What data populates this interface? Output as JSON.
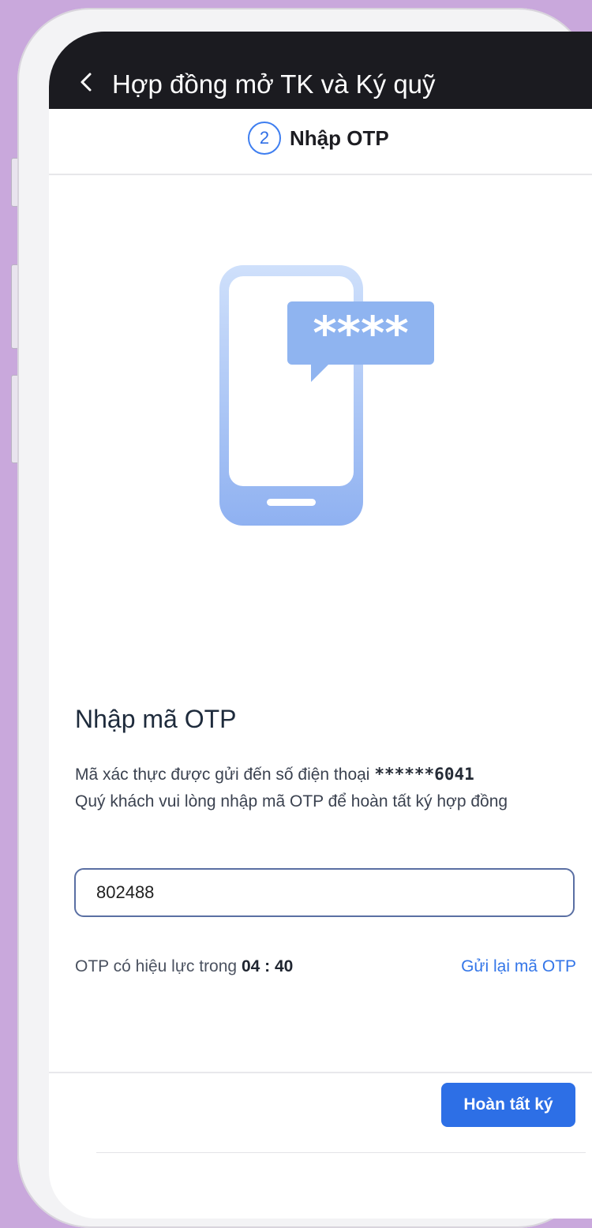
{
  "header": {
    "title": "Hợp đồng mở TK và Ký quỹ",
    "back_icon": "chevron-left-icon"
  },
  "step": {
    "number": "2",
    "label": "Nhập OTP"
  },
  "illustration": {
    "bubble_text": "****",
    "icon": "phone-message-illustration"
  },
  "otp": {
    "title": "Nhập mã OTP",
    "desc_prefix": "Mã xác thực được gửi đến số điện thoại ",
    "masked_phone": "******6041",
    "desc_suffix": "Quý khách vui lòng nhập mã OTP để hoàn tất ký hợp đồng",
    "input_value": "802488",
    "timer_label": "OTP có hiệu lực trong ",
    "timer_value": "04 : 40",
    "resend_label": "Gửi lại mã OTP"
  },
  "footer": {
    "complete_label": "Hoàn tất ký",
    "accent_color": "#2d6fe6"
  }
}
